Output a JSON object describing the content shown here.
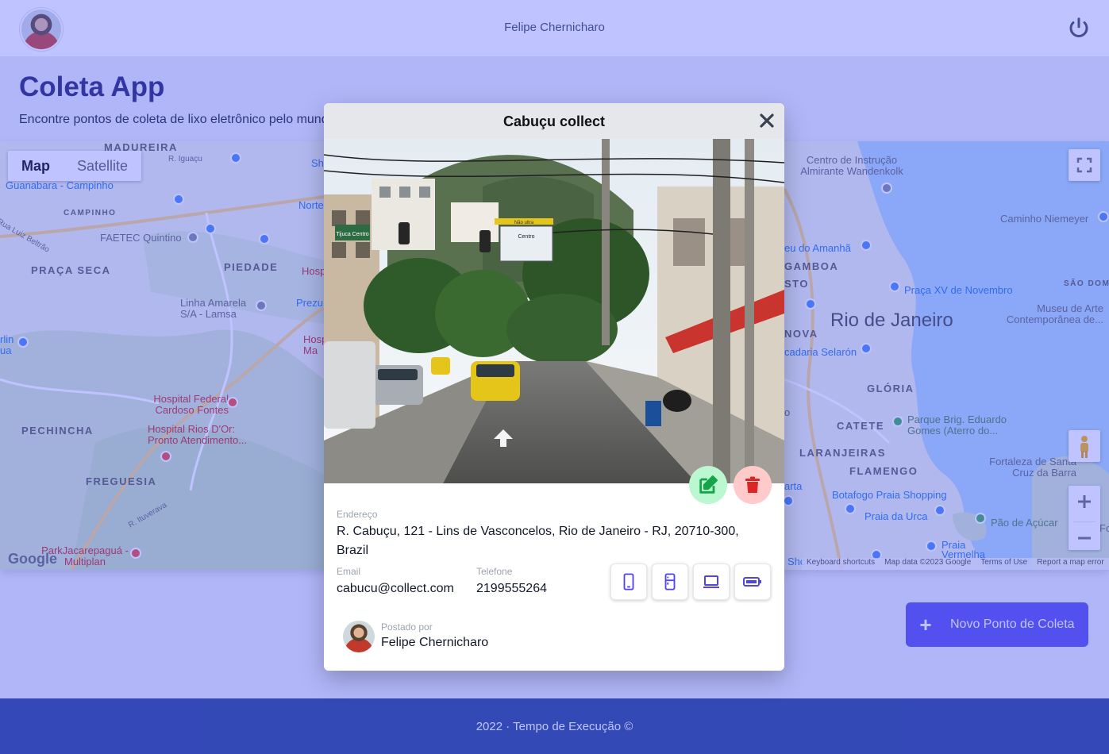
{
  "header": {
    "user_name": "Felipe Chernicharo"
  },
  "page": {
    "title": "Coleta App",
    "subtitle": "Encontre pontos de coleta de lixo eletrônico pelo mundo"
  },
  "map": {
    "type_buttons": [
      "Map",
      "Satellite"
    ],
    "active_type": "Map",
    "labels": {
      "madureira": "MADUREIRA",
      "r_iguacu": "R. Iguaçu",
      "guanabara": "Guanabara - Campinho",
      "campinho": "CAMPINHO",
      "luiz_beltrao": "Rua Luiz Beltrão",
      "faetec": "FAETEC Quintino",
      "praca_seca": "PRAÇA SECA",
      "piedade": "PIEDADE",
      "linha_amarela": "Linha Amarela S/A - Lamsa",
      "hosp_cardoso": "Hospital Federal Cardoso Fontes",
      "hosp_rios": "Hospital Rios D'Or: Pronto Atendimento...",
      "pechincha": "PECHINCHA",
      "freguesia": "FREGUESIA",
      "r_ituverava": "R. Ituverava",
      "park_jacare": "ParkJacarepaguá - Multiplan",
      "centro_instrucao": "Centro de Instrução Almirante Wandenkolk",
      "caminho_niemeyer": "Caminho Niemeyer",
      "museu_amanha": "eu do Amanhã",
      "gamboa": "GAMBOA",
      "sto": "STO",
      "praca_xv": "Praça XV de Novembro",
      "sao_domingos": "SÃO DOMIN",
      "museu_arte": "Museu de Arte Contemporânea de...",
      "rio": "Rio de Janeiro",
      "nova": "NOVA",
      "selaron": "cadaria Selarón",
      "gloria": "GLÓRIA",
      "catete": "CATETE",
      "parque_brig": "Parque Brig. Eduardo Gomes (Aterro do...",
      "laranjeiras": "LARANJEIRAS",
      "fortaleza": "Fortaleza de Santa Cruz da Barra",
      "flamengo": "FLAMENGO",
      "botafogo": "Botafogo Praia Shopping",
      "praia_urca": "Praia da Urca",
      "pao_acucar": "Pão de Açúcar",
      "praia_vermelha": "Praia Vermelha",
      "shc": "Shc",
      "norte": "Norte",
      "shop": "Sh",
      "hosp_partial": "Hosp",
      "prezu": "Prezu",
      "hosp_ma": "Hosp Ma",
      "arta": "arta",
      "lin": "rlin ua",
      "o": "o",
      "fo": "Fo"
    },
    "google_logo": "Google",
    "attribution": [
      "Keyboard shortcuts",
      "Map data ©2023 Google",
      "Terms of Use",
      "Report a map error"
    ]
  },
  "modal": {
    "title": "Cabuçu collect",
    "address_label": "Endereço",
    "address": "R. Cabuçu, 121 - Lins de Vasconcelos, Rio de Janeiro - RJ, 20710-300, Brazil",
    "email_label": "Email",
    "email": "cabucu@collect.com",
    "phone_label": "Telefone",
    "phone": "2199555264",
    "posted_by_label": "Postado por",
    "posted_by": "Felipe Chernicharo",
    "photo_signs": {
      "tijuca": "Tijuca Centro",
      "direction": "Não ultra",
      "sign2": "Centro"
    }
  },
  "novo_button": {
    "icon": "+",
    "label": "Novo Ponto de Coleta"
  },
  "footer": {
    "text": "2022 · Tempo de Execução ©"
  },
  "colors": {
    "overlay": "#5860ff",
    "primary": "#4f46e5",
    "footer": "#1e3a8a",
    "edit_bg": "#bbf7d0",
    "edit_icon": "#16a34a",
    "delete_bg": "#fecaca",
    "delete_icon": "#dc2626",
    "type_icon": "#4f46e5"
  }
}
